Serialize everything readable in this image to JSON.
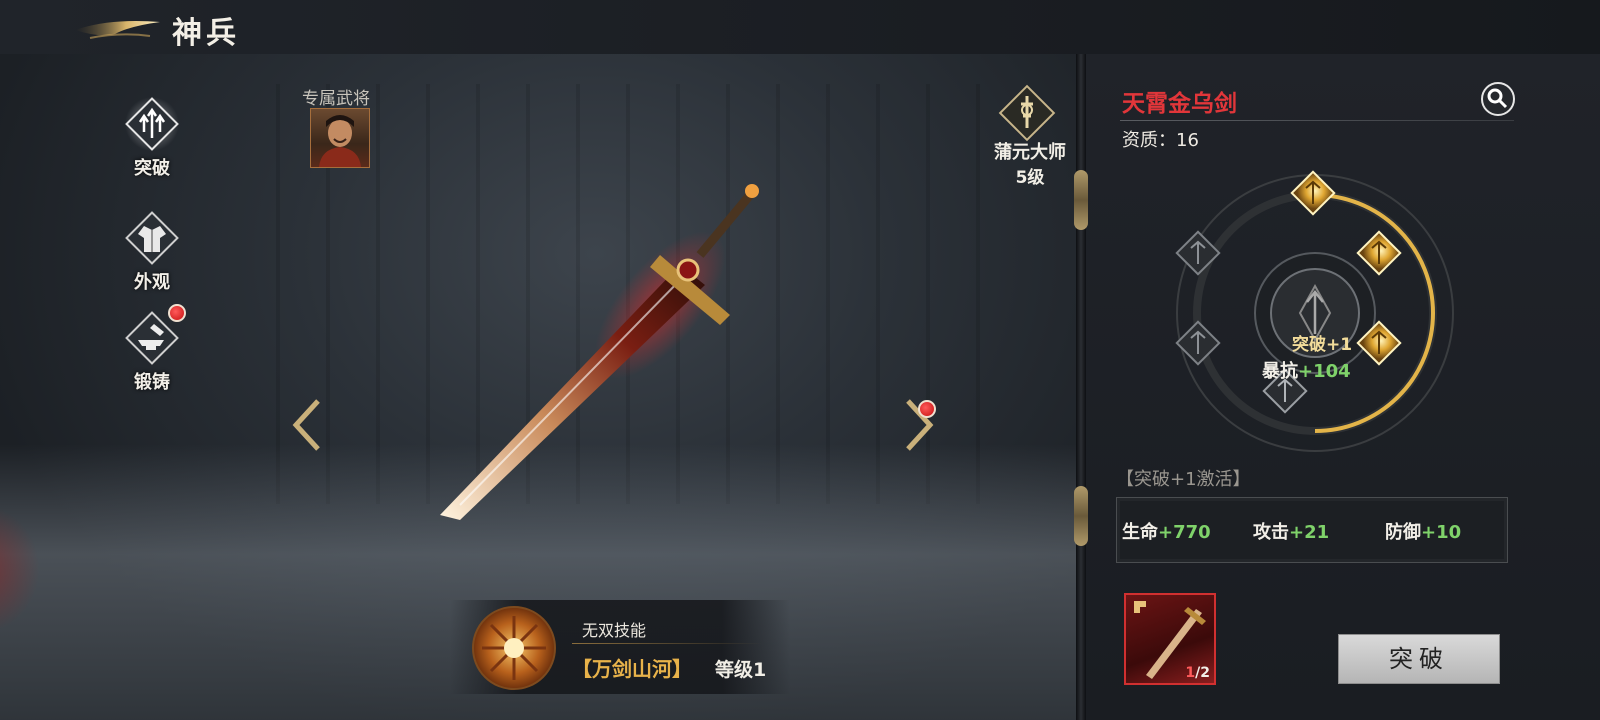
{
  "header": {
    "title": "神兵"
  },
  "side_menu": [
    {
      "label": "突破",
      "icon": "trident-up-icon",
      "active": true,
      "badge": false
    },
    {
      "label": "外观",
      "icon": "robe-icon",
      "active": false,
      "badge": false
    },
    {
      "label": "锻铸",
      "icon": "anvil-icon",
      "active": false,
      "badge": true
    }
  ],
  "exclusive_general": {
    "label": "专属武将"
  },
  "master": {
    "name": "蒲元大师",
    "level": "5级"
  },
  "skill": {
    "type": "无双技能",
    "name": "【万剑山河】",
    "level": "等级1"
  },
  "weapon": {
    "name": "天霄金乌剑",
    "aptitude": "资质：16",
    "name_color": "#e2363a"
  },
  "breakthrough": {
    "center_text": "突破",
    "center_value": "+1",
    "stat_label": "暴抗",
    "stat_value": "+104",
    "activated_nodes": 4,
    "total_nodes": 7
  },
  "activation": {
    "title": "【突破+1激活】",
    "stats": [
      {
        "label": "生命",
        "value": "+770"
      },
      {
        "label": "攻击",
        "value": "+21"
      },
      {
        "label": "防御",
        "value": "+10"
      }
    ]
  },
  "material": {
    "have": "1",
    "need": "/2"
  },
  "break_button": {
    "label": "突破"
  },
  "colors": {
    "gold": "#e8b24a",
    "green_stat": "#7fd26a",
    "red_title": "#e2363a"
  }
}
